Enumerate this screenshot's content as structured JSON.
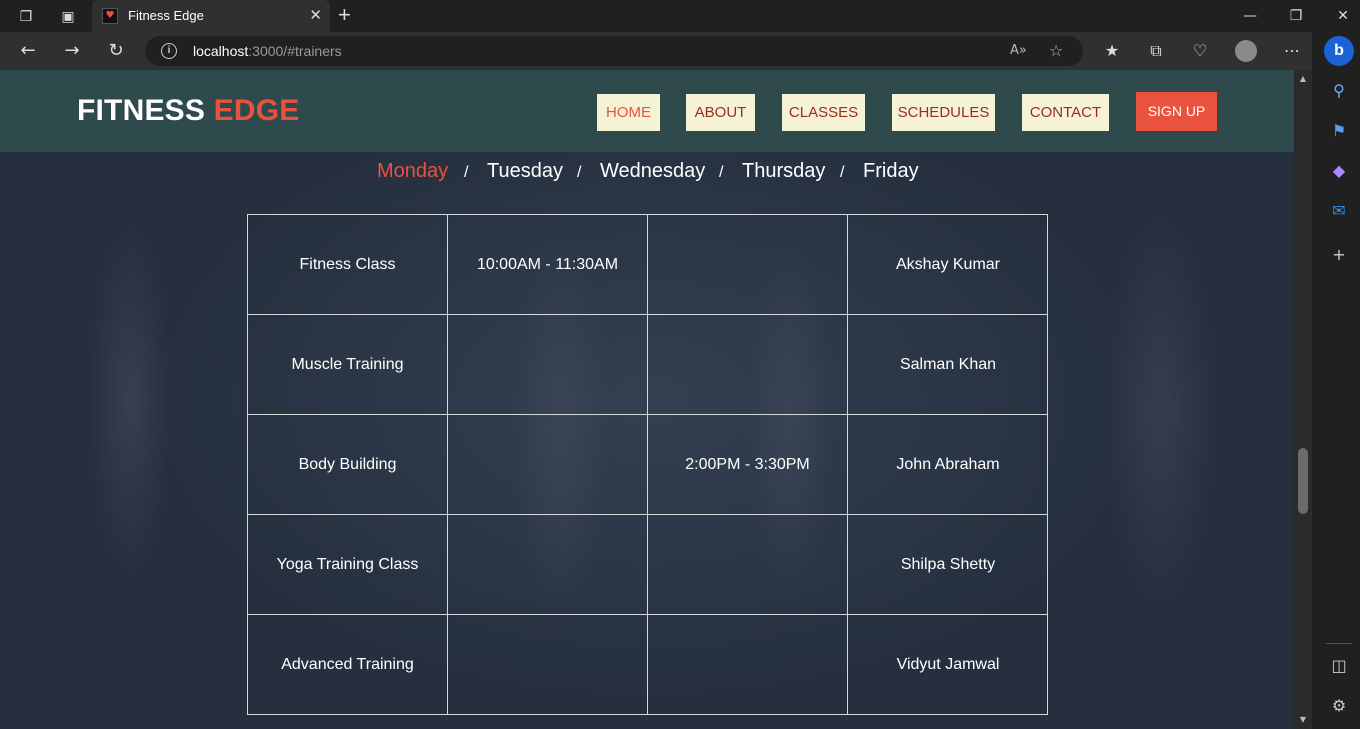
{
  "browser": {
    "tab_title": "Fitness Edge",
    "new_tab_label": "+",
    "url_host": "localhost",
    "url_path": ":3000/#trainers",
    "read_aloud_label": "A»"
  },
  "header": {
    "logo_main": "FITNESS",
    "logo_accent": "EDGE",
    "nav": [
      {
        "label": "HOME",
        "active": true
      },
      {
        "label": "ABOUT",
        "active": false
      },
      {
        "label": "CLASSES",
        "active": false
      },
      {
        "label": "SCHEDULES",
        "active": false
      },
      {
        "label": "CONTACT",
        "active": false
      }
    ],
    "signup_label": "SIGN UP"
  },
  "schedule": {
    "days": [
      "Monday",
      "Tuesday",
      "Wednesday",
      "Thursday",
      "Friday"
    ],
    "active_day": "Monday",
    "separator": "/",
    "rows": [
      [
        "Fitness Class",
        "10:00AM - 11:30AM",
        "",
        "Akshay Kumar"
      ],
      [
        "Muscle Training",
        "",
        "",
        "Salman Khan"
      ],
      [
        "Body Building",
        "",
        "2:00PM - 3:30PM",
        "John Abraham"
      ],
      [
        "Yoga Training Class",
        "",
        "",
        "Shilpa Shetty"
      ],
      [
        "Advanced Training",
        "",
        "",
        "Vidyut Jamwal"
      ]
    ]
  },
  "colors": {
    "accent": "#e8523f",
    "header_bg": "#2f4a4c",
    "nav_bg": "#f6f2d5",
    "nav_text": "#9b2c24"
  },
  "icons": {
    "bing": "b"
  }
}
